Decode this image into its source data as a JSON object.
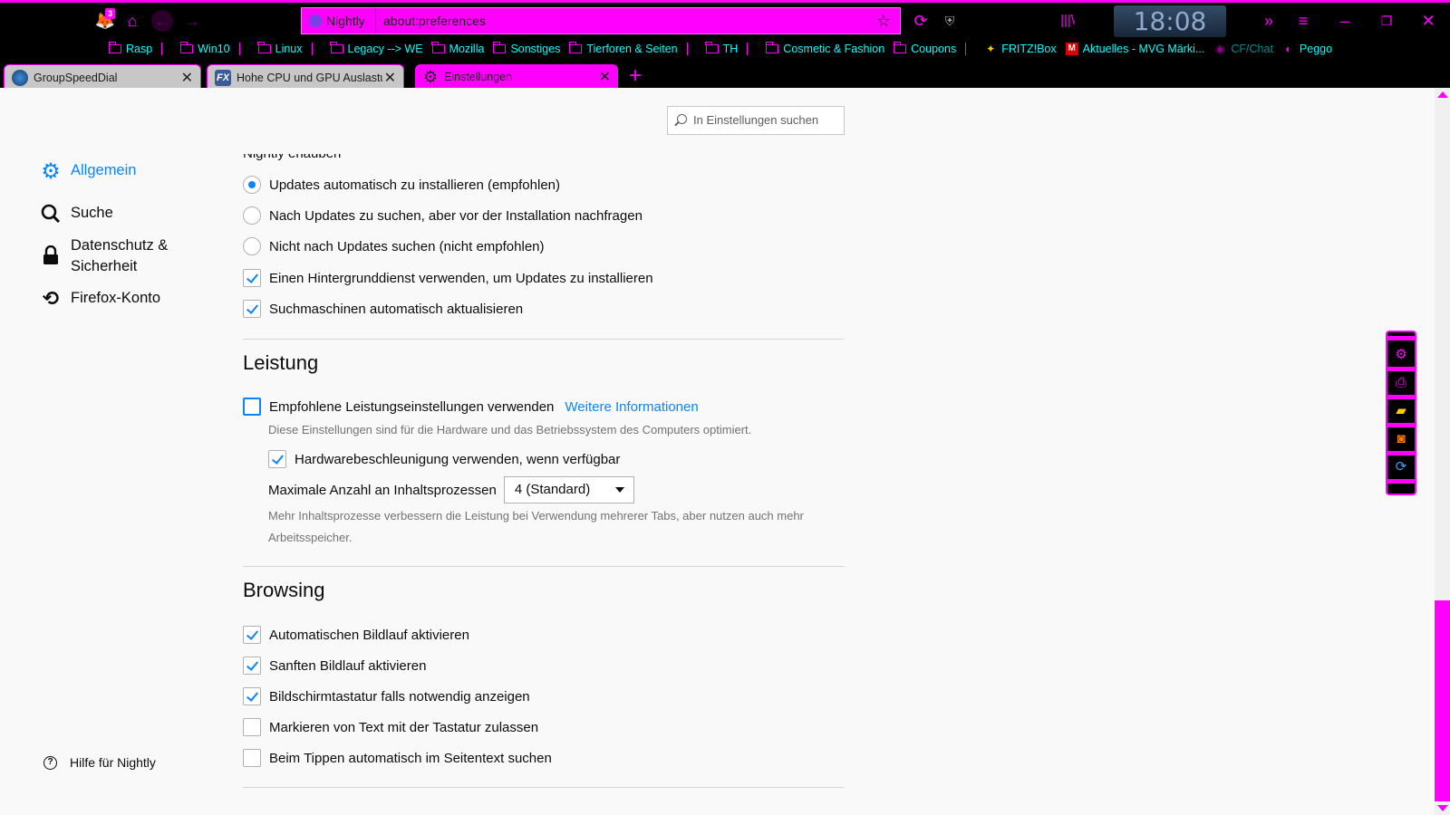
{
  "chrome": {
    "badge_count": "3",
    "identity_label": "Nightly",
    "url": "about:preferences",
    "clock": "18:08",
    "accent_color": "#ff00ff",
    "bookmark_text_color": "#00ffff"
  },
  "bookmarks": [
    {
      "label": "Rasp",
      "icon": "folder-icon"
    },
    {
      "label": "Win10",
      "icon": "folder-icon"
    },
    {
      "label": "Linux",
      "icon": "folder-icon"
    },
    {
      "label": "Legacy --> WE",
      "icon": "folder-icon"
    },
    {
      "label": "Mozilla",
      "icon": "folder-icon"
    },
    {
      "label": "Sonstiges",
      "icon": "folder-icon"
    },
    {
      "label": "Tierforen & Seiten",
      "icon": "folder-icon"
    },
    {
      "label": "TH",
      "icon": "folder-icon"
    },
    {
      "label": "Cosmetic & Fashion",
      "icon": "folder-icon"
    },
    {
      "label": "Coupons",
      "icon": "folder-icon"
    },
    {
      "label": "FRITZ!Box",
      "icon": "fritzbox-icon"
    },
    {
      "label": "Aktuelles - MVG Märki...",
      "icon": "mvg-icon"
    },
    {
      "label": "CF/Chat",
      "icon": "chat-icon"
    },
    {
      "label": "Peggo",
      "icon": "peggo-icon"
    }
  ],
  "tabs": [
    {
      "title": "GroupSpeedDial",
      "active": false
    },
    {
      "title": "Hohe CPU und GPU Auslastung",
      "active": false
    },
    {
      "title": "Einstellungen",
      "active": true
    }
  ],
  "prefs": {
    "search_placeholder": "In Einstellungen suchen",
    "categories": [
      {
        "label": "Allgemein",
        "icon": "gear-icon",
        "selected": true
      },
      {
        "label": "Suche",
        "icon": "search-icon",
        "selected": false
      },
      {
        "label": "Datenschutz & Sicherheit",
        "icon": "lock-icon",
        "selected": false
      },
      {
        "label": "Firefox-Konto",
        "icon": "sync-icon",
        "selected": false
      }
    ],
    "help_label": "Hilfe für Nightly",
    "updates": {
      "partial_heading": "Nightly erlauben",
      "radio_auto": "Updates automatisch zu installieren (empfohlen)",
      "radio_ask": "Nach Updates zu suchen, aber vor der Installation nachfragen",
      "radio_never": "Nicht nach Updates suchen (nicht empfohlen)",
      "background_service": "Einen Hintergrunddienst verwenden, um Updates zu installieren",
      "search_engines_update": "Suchmaschinen automatisch aktualisieren"
    },
    "performance": {
      "heading": "Leistung",
      "recommended": "Empfohlene Leistungseinstellungen verwenden",
      "learn_more": "Weitere Informationen",
      "recommended_desc": "Diese Einstellungen sind für die Hardware und das Betriebssystem des Computers optimiert.",
      "hw_accel": "Hardwarebeschleunigung verwenden, wenn verfügbar",
      "content_processes_label": "Maximale Anzahl an Inhaltsprozessen",
      "content_processes_value": "4 (Standard)",
      "content_processes_desc": "Mehr Inhaltsprozesse verbessern die Leistung bei Verwendung mehrerer Tabs, aber nutzen auch mehr Arbeitsspeicher."
    },
    "browsing": {
      "heading": "Browsing",
      "autoscroll": "Automatischen Bildlauf aktivieren",
      "smooth_scroll": "Sanften Bildlauf aktivieren",
      "touch_keyboard": "Bildschirmtastatur falls notwendig anzeigen",
      "caret_browsing": "Markieren von Text mit der Tastatur zulassen",
      "find_as_you_type": "Beim Tippen automatisch im Seitentext suchen"
    }
  }
}
